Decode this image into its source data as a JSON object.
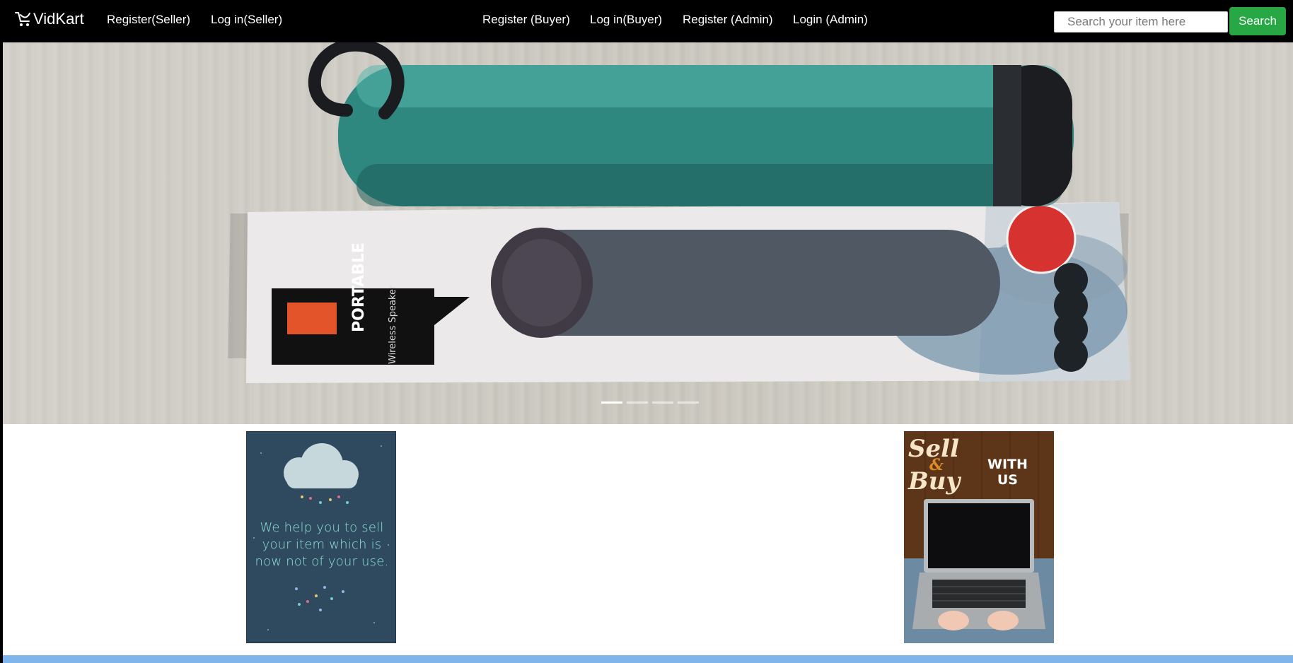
{
  "nav": {
    "brand": "VidKart",
    "links": [
      "Register(Seller)",
      "Log in(Seller)",
      "Register (Buyer)",
      "Log in(Buyer)",
      "Register (Admin)",
      "Login (Admin)"
    ],
    "search": {
      "placeholder": "Search your item here",
      "button_label": "Search"
    }
  },
  "carousel": {
    "slide_count": 4,
    "active_index": 0,
    "slide_text": {
      "product_label": "PORTABLE",
      "product_sub": "Wireless Speaker"
    }
  },
  "promos": {
    "left": {
      "text": "We help you to sell your item which is now not of your use."
    },
    "right": {
      "title_1": "Sell",
      "amp": "&",
      "title_2": "Buy",
      "with": "WITH",
      "us": "US"
    }
  },
  "colors": {
    "navbar": "#000000",
    "search_button": "#28a745",
    "bottom_band": "#7fb5ea"
  }
}
